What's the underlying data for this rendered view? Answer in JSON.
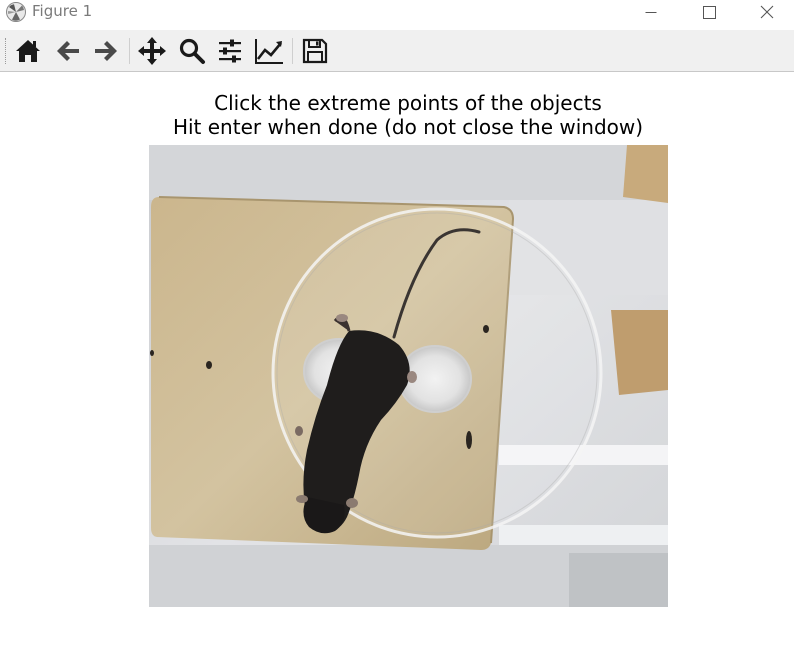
{
  "window": {
    "title": "Figure 1"
  },
  "toolbar": {
    "buttons": [
      {
        "name": "home-button",
        "icon": "home-icon"
      },
      {
        "name": "back-button",
        "icon": "arrow-left-icon"
      },
      {
        "name": "forward-button",
        "icon": "arrow-right-icon"
      },
      {
        "name": "pan-button",
        "icon": "move-icon"
      },
      {
        "name": "zoom-button",
        "icon": "magnifier-icon"
      },
      {
        "name": "subplots-button",
        "icon": "sliders-icon"
      },
      {
        "name": "edit-axes-button",
        "icon": "line-chart-icon"
      },
      {
        "name": "save-button",
        "icon": "floppy-disk-icon"
      }
    ]
  },
  "figure": {
    "title_line1": "Click the extreme points of the objects",
    "title_line2": "Hit enter when done (do not close the window)",
    "image": "photo of a black mouse on a wooden square platform with a clear acrylic disc, seen from above"
  },
  "colors": {
    "toolbar_bg": "#f0f0f0",
    "icon": "#1a1a1a",
    "board": "#c8b287"
  }
}
